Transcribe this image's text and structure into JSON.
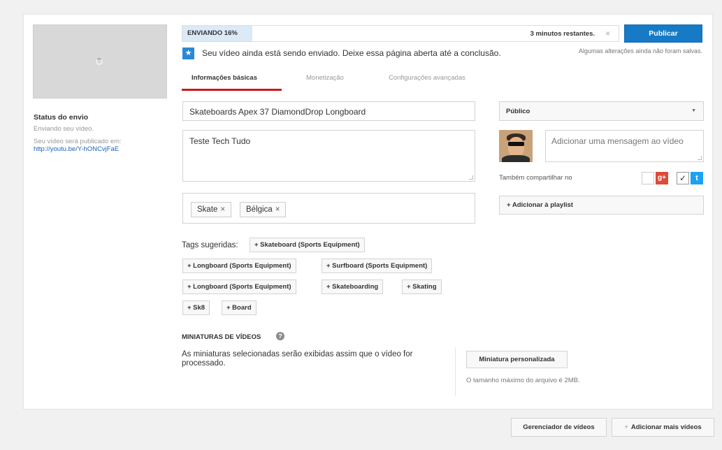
{
  "upload": {
    "progress_label": "ENVIANDO 16%",
    "progress_percent": 16,
    "remaining": "3 minutos restantes.",
    "close_glyph": "×",
    "publish_label": "Publicar",
    "notice_icon": "star-icon",
    "notice_text": "Seu vídeo ainda está sendo enviado. Deixe essa página aberta até a conclusão.",
    "unsaved_text": "Algumas alterações ainda não foram salvas."
  },
  "sidebar": {
    "status_title": "Status do envio",
    "status_sub": "Enviando seu vídeo.",
    "url_label": "Seu vídeo será publicado em:",
    "url": "http://youtu.be/Y-hONCvjFaE"
  },
  "tabs": [
    {
      "label": "Informações básicas",
      "active": true
    },
    {
      "label": "Monetização",
      "active": false
    },
    {
      "label": "Configurações avançadas",
      "active": false
    }
  ],
  "form": {
    "title_value": "Skateboards Apex 37 DiamondDrop Longboard",
    "description_value": "Teste Tech Tudo",
    "tags": [
      "Skate",
      "Bélgica"
    ],
    "tag_remove_glyph": "×",
    "suggested_label": "Tags sugeridas:",
    "suggested_tags": [
      "+ Skateboard (Sports Equipment)",
      "+ Longboard (Sports Equipment)",
      "+ Surfboard (Sports Equipment)",
      "+ Longboard (Sports Equipment)",
      "+ Skateboarding",
      "+ Skating",
      "+ Sk8",
      "+ Board"
    ]
  },
  "thumbnails": {
    "title": "MINIATURAS DE VÍDEOS",
    "help_glyph": "?",
    "description": "As miniaturas selecionadas serão exibidas assim que o vídeo for processado.",
    "custom_button": "Miniatura personalizada",
    "max_size": "O tamanho máximo do arquivo é 2MB."
  },
  "right": {
    "privacy_value": "Público",
    "caret_glyph": "▼",
    "message_placeholder": "Adicionar uma mensagem ao vídeo",
    "share_label": "Também compartilhar no",
    "gplus_glyph": "g+",
    "twitter_glyph": "t",
    "check_glyph": "✓",
    "playlist_label": "+ Adicionar à playlist"
  },
  "footer": {
    "manager_label": "Gerenciador de vídeos",
    "add_more_plus": "+",
    "add_more_label": "Adicionar mais vídeos"
  },
  "colors": {
    "accent": "#167ac6",
    "tab_underline": "#cc181e",
    "link": "#1c62b9",
    "progress_fill": "#dce9f7"
  }
}
